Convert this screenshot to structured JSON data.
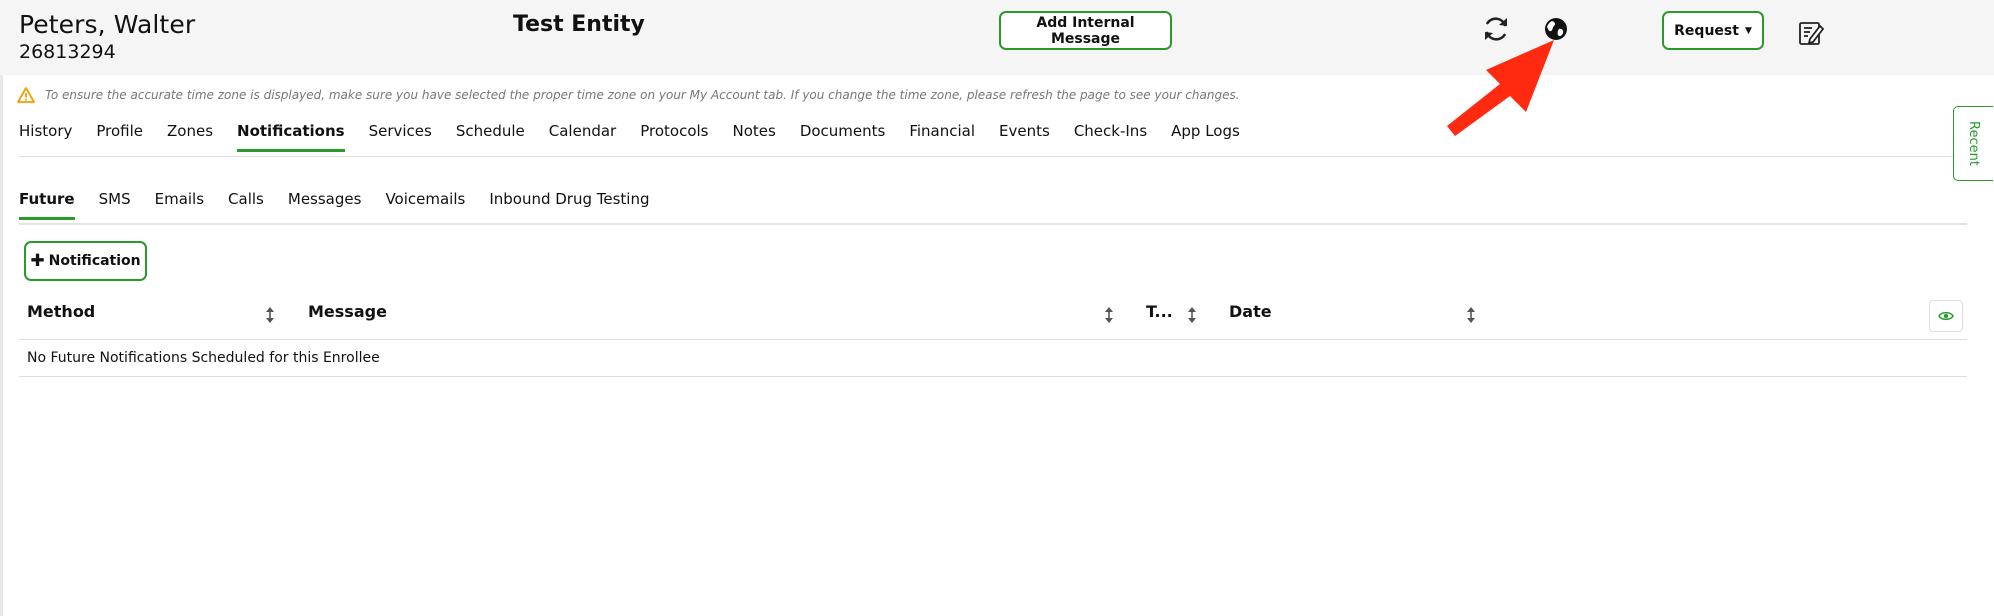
{
  "header": {
    "enrollee_name": "Peters, Walter",
    "enrollee_id": "26813294",
    "entity_name": "Test Entity",
    "add_message_label": "Add Internal Message",
    "request_label": "Request",
    "icons": [
      "refresh-icon",
      "globe-icon",
      "notes-edit-icon"
    ]
  },
  "banner": {
    "timezone_notice": "To ensure the accurate time zone is displayed, make sure you have selected the proper time zone on your My Account tab. If you change the time zone, please refresh the page to see your changes."
  },
  "main_tabs": [
    {
      "label": "History",
      "active": false
    },
    {
      "label": "Profile",
      "active": false
    },
    {
      "label": "Zones",
      "active": false
    },
    {
      "label": "Notifications",
      "active": true
    },
    {
      "label": "Services",
      "active": false
    },
    {
      "label": "Schedule",
      "active": false
    },
    {
      "label": "Calendar",
      "active": false
    },
    {
      "label": "Protocols",
      "active": false
    },
    {
      "label": "Notes",
      "active": false
    },
    {
      "label": "Documents",
      "active": false
    },
    {
      "label": "Financial",
      "active": false
    },
    {
      "label": "Events",
      "active": false
    },
    {
      "label": "Check-Ins",
      "active": false
    },
    {
      "label": "App Logs",
      "active": false
    }
  ],
  "sub_tabs": [
    {
      "label": "Future",
      "active": true
    },
    {
      "label": "SMS",
      "active": false
    },
    {
      "label": "Emails",
      "active": false
    },
    {
      "label": "Calls",
      "active": false
    },
    {
      "label": "Messages",
      "active": false
    },
    {
      "label": "Voicemails",
      "active": false
    },
    {
      "label": "Inbound Drug Testing",
      "active": false
    }
  ],
  "toolbar": {
    "add_notification_label": "Notification"
  },
  "table": {
    "columns": [
      "Method",
      "Message",
      "T...",
      "Date"
    ],
    "empty_message": "No Future Notifications Scheduled for this Enrollee"
  },
  "side_panel": {
    "recent_label": "Recent"
  },
  "colors": {
    "accent": "#2a9a2a",
    "header_bg": "#f5f5f5",
    "warning": "#f0a000",
    "annotation_arrow": "#ff2a10"
  }
}
